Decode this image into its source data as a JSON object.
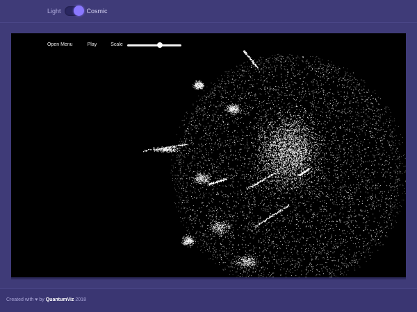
{
  "theme_toggle": {
    "left_label": "Light",
    "right_label": "Cosmic",
    "selected": "Cosmic"
  },
  "controls": {
    "open_menu_label": "Open Menu",
    "play_label": "Play",
    "scale_label": "Scale",
    "scale_value": 0.6
  },
  "footer": {
    "prefix": "Created with",
    "heart_icon": "♥",
    "by": "by",
    "brand": "QuantumViz",
    "year": "2018"
  },
  "colors": {
    "background": "#3f3b78",
    "stage": "#000000",
    "accent": "#8a78ff",
    "points": "#ffffff"
  }
}
